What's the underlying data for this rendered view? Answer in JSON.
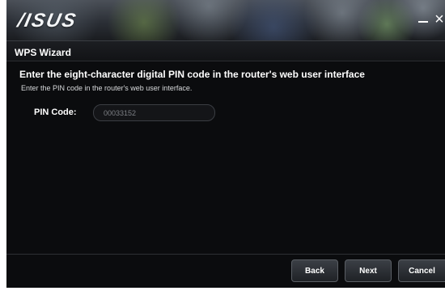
{
  "app": {
    "logo": "/ISUS",
    "window_controls": {
      "minimize": "minimize-icon",
      "close": "×"
    }
  },
  "wizard": {
    "title": "WPS Wizard",
    "heading": "Enter the eight-character digital PIN code in the router's web user interface",
    "subtext": "Enter the PIN code in the router's web user interface."
  },
  "form": {
    "pin_label": "PIN Code:",
    "pin_value": "00033152"
  },
  "buttons": {
    "back": "Back",
    "next": "Next",
    "cancel": "Cancel"
  },
  "colors": {
    "background": "#0b0c0e",
    "text": "#ffffff"
  }
}
